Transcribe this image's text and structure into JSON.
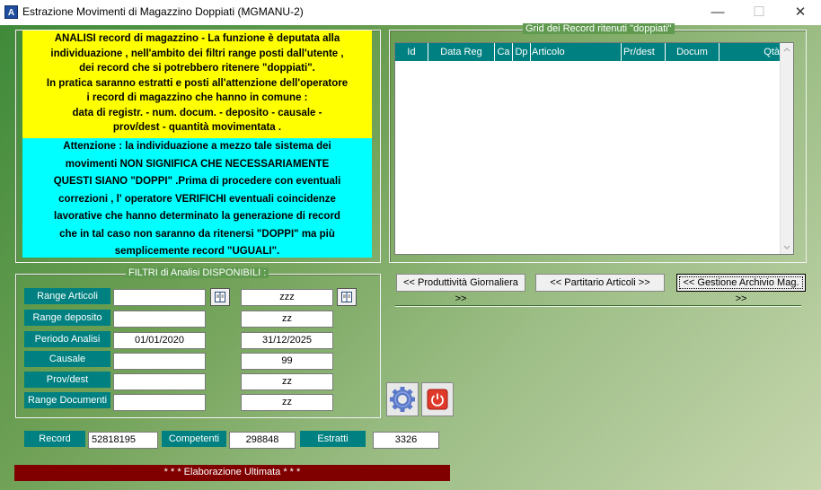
{
  "window": {
    "title": "Estrazione Movimenti di Magazzino Doppiati (MGMANU-2)",
    "icon_letter": "A",
    "minimize": "—",
    "maximize": "☐",
    "close": "✕"
  },
  "info": {
    "yellow_lines": [
      "ANALISI record di magazzino - La funzione è deputata alla",
      "individuazione , nell'ambito dei filtri range posti dall'utente ,",
      "dei record che si potrebbero ritenere \"doppiati\".",
      "In pratica saranno estratti e posti all'attenzione dell'operatore",
      "i record  di magazzino che hanno in comune :",
      "data di registr. - num. docum. -  deposito - causale -",
      "prov/dest - quantità movimentata ."
    ],
    "cyan_lines": [
      "Attenzione : la individuazione a mezzo tale sistema dei",
      "movimenti  NON SIGNIFICA CHE NECESSARIAMENTE",
      "QUESTI SIANO \"DOPPI\" .Prima di procedere con eventuali",
      "correzioni , l' operatore VERIFICHI  eventuali coincidenze",
      "lavorative che hanno determinato la generazione di record",
      "che in tal caso non saranno da ritenersi \"DOPPI\" ma più",
      "semplicemente record \"UGUALI\"."
    ]
  },
  "grid": {
    "legend": "Grid dei Record ritenuti \"doppiati\"",
    "columns": [
      "Id",
      "Data Reg",
      "Ca",
      "Dp",
      "Articolo",
      "Pr/dest",
      "Docum",
      "Qtà"
    ]
  },
  "nav_buttons": {
    "produttivita": "<< Produttività Giornaliera >>",
    "partitario": "<< Partitario Articoli >>",
    "gestione": "<< Gestione Archivio Mag. >>"
  },
  "filters": {
    "legend": "FILTRI di Analisi DISPONIBILI :",
    "range_articoli": {
      "label": "Range Articoli",
      "from": "",
      "to": "zzz"
    },
    "range_deposito": {
      "label": "Range deposito",
      "from": "",
      "to": "zz"
    },
    "periodo_analisi": {
      "label": "Periodo Analisi",
      "from": "01/01/2020",
      "to": "31/12/2025"
    },
    "causale": {
      "label": "Causale",
      "from": "",
      "to": "99"
    },
    "prov_dest": {
      "label": "Prov/dest",
      "from": "",
      "to": "zz"
    },
    "range_documenti": {
      "label": "Range Documenti",
      "from": "",
      "to": "zz"
    }
  },
  "counters": {
    "record": {
      "label": "Record",
      "value": "52818195"
    },
    "competenti": {
      "label": "Competenti",
      "value": "298848"
    },
    "estratti": {
      "label": "Estratti",
      "value": "3326"
    }
  },
  "status": "* * *  Elaborazione Ultimata  * * *",
  "icons": {
    "lookup": "book-icon",
    "settings": "gear-icon",
    "exit": "power-icon"
  },
  "colors": {
    "teal": "#008080",
    "yellow": "#ffff00",
    "cyan": "#00ffff",
    "status_bg": "#800000"
  }
}
